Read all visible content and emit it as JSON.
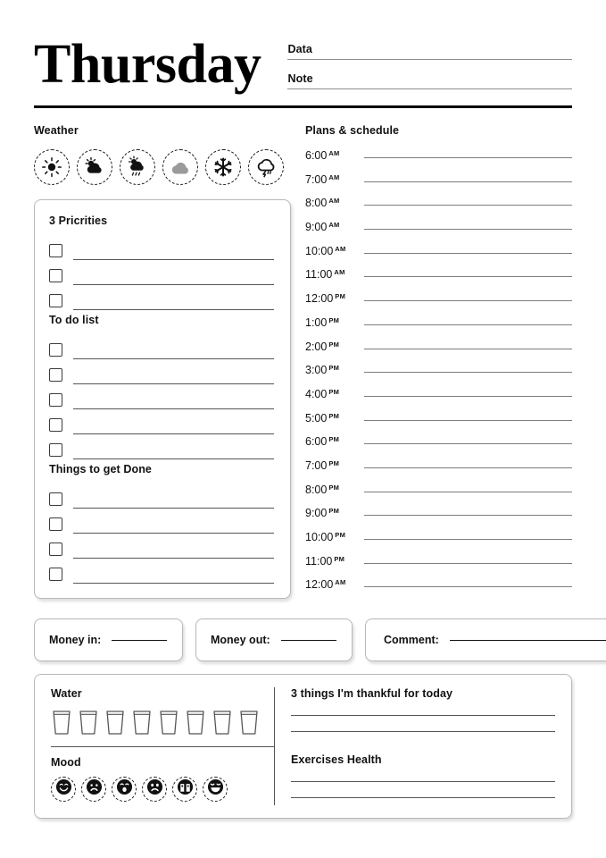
{
  "header": {
    "day_title": "Thursday",
    "fields": [
      {
        "label": "Data"
      },
      {
        "label": "Note"
      }
    ]
  },
  "weather": {
    "title": "Weather",
    "icons": [
      {
        "name": "sun-icon",
        "label": "Sunny"
      },
      {
        "name": "sun-cloud-icon",
        "label": "Partly cloudy"
      },
      {
        "name": "sun-cloud-rain-icon",
        "label": "Cloudy with showers"
      },
      {
        "name": "cloud-icon",
        "label": "Cloudy"
      },
      {
        "name": "snowflake-icon",
        "label": "Snow"
      },
      {
        "name": "cloud-rain-storm-icon",
        "label": "Rain storm"
      }
    ]
  },
  "tasks": {
    "priorities": {
      "title": "3 Pricrities",
      "rows": 3
    },
    "todo": {
      "title": "To do list",
      "rows": 5
    },
    "things_done": {
      "title": "Things to get Done",
      "rows": 4
    }
  },
  "schedule": {
    "title": "Plans & schedule",
    "slots": [
      {
        "time": "6:00",
        "meridiem": "AM"
      },
      {
        "time": "7:00",
        "meridiem": "AM"
      },
      {
        "time": "8:00",
        "meridiem": "AM"
      },
      {
        "time": "9:00",
        "meridiem": "AM"
      },
      {
        "time": "10:00",
        "meridiem": "AM"
      },
      {
        "time": "11:00",
        "meridiem": "AM"
      },
      {
        "time": "12:00",
        "meridiem": "PM"
      },
      {
        "time": "1:00",
        "meridiem": "PM"
      },
      {
        "time": "2:00",
        "meridiem": "PM"
      },
      {
        "time": "3:00",
        "meridiem": "PM"
      },
      {
        "time": "4:00",
        "meridiem": "PM"
      },
      {
        "time": "5:00",
        "meridiem": "PM"
      },
      {
        "time": "6:00",
        "meridiem": "PM"
      },
      {
        "time": "7:00",
        "meridiem": "PM"
      },
      {
        "time": "8:00",
        "meridiem": "PM"
      },
      {
        "time": "9:00",
        "meridiem": "PM"
      },
      {
        "time": "10:00",
        "meridiem": "PM"
      },
      {
        "time": "11:00",
        "meridiem": "PM"
      },
      {
        "time": "12:00",
        "meridiem": "AM"
      }
    ]
  },
  "money": {
    "money_in_label": "Money in:",
    "money_out_label": "Money out:",
    "comment_label": "Comment:"
  },
  "tracker": {
    "water": {
      "title": "Water",
      "glasses": 8
    },
    "mood": {
      "title": "Mood",
      "faces": [
        {
          "name": "mood-happy-icon",
          "label": "Happy"
        },
        {
          "name": "mood-sad-icon",
          "label": "Sad"
        },
        {
          "name": "mood-surprised-icon",
          "label": "Surprised"
        },
        {
          "name": "mood-frowning-icon",
          "label": "Frowning"
        },
        {
          "name": "mood-crying-icon",
          "label": "Crying"
        },
        {
          "name": "mood-laughing-icon",
          "label": "Laughing"
        }
      ]
    },
    "thankful": {
      "title": "3 things I'm thankful for today",
      "rows": 2
    },
    "exercises": {
      "title": "Exercises Health",
      "rows": 2
    }
  },
  "colors": {
    "ink": "#111111",
    "rule": "#555555",
    "card_border": "#b8b8b8",
    "cloud_gray": "#9a9a9a"
  }
}
